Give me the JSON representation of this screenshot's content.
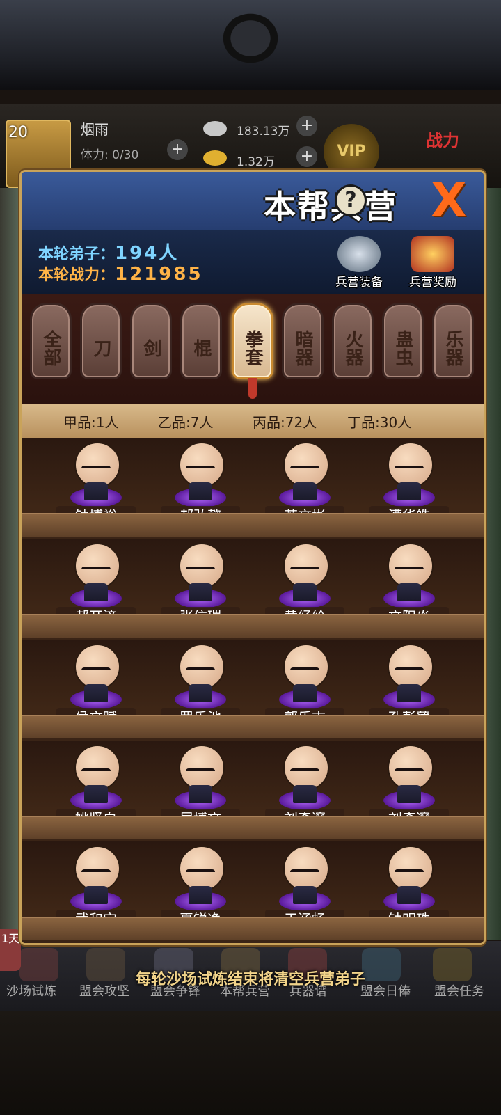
{
  "player": {
    "level": "20",
    "name": "烟雨",
    "stamina": "体力: 0/30",
    "silver": "183.13万",
    "gold": "1.32万",
    "vip": "VIP",
    "power_label": "战力"
  },
  "modal": {
    "title": "本帮兵营",
    "help": "?",
    "close": "X",
    "disciples_label": "本轮弟子：",
    "disciples_value": "194人",
    "power_label": "本轮战力：",
    "power_value": "121985",
    "equip_button": "兵营装备",
    "reward_button": "兵营奖励"
  },
  "tabs": [
    "全部",
    "刀",
    "剑",
    "棍",
    "拳套",
    "暗器",
    "火器",
    "蛊虫",
    "乐器"
  ],
  "active_tab": "拳套",
  "grades": [
    "甲品:1人",
    "乙品:7人",
    "丙品:72人",
    "丁品:30人"
  ],
  "disciples": [
    [
      "钟博裕",
      "郝弘懿",
      "苏文彬",
      "漕华皓"
    ],
    [
      "郝开济",
      "张信瑞",
      "黄经纶",
      "文阳焱"
    ],
    [
      "侯文赋",
      "罗乐池",
      "郭乐志",
      "孔彭薄"
    ],
    [
      "姚坚白",
      "居博文",
      "刘奇邃",
      "刘奇邃"
    ],
    [
      "武和宜",
      "夏锐逸",
      "于涵畅",
      "钟明珠"
    ]
  ],
  "footer_message": "每轮沙场试炼结束将清空兵营弟子",
  "day_badge": "1天",
  "bottom_nav": [
    "沙场试炼",
    "盟会攻坚",
    "盟会争锋",
    "本帮兵营",
    "兵器谱",
    "盟会日俸",
    "盟会任务"
  ],
  "colors": {
    "header_blue": "#2f4a85",
    "disciples_text": "#7fd4ff",
    "power_text": "#ffb347",
    "active_tab": "#f6e6cc",
    "glow_purple": "#b46aff"
  }
}
